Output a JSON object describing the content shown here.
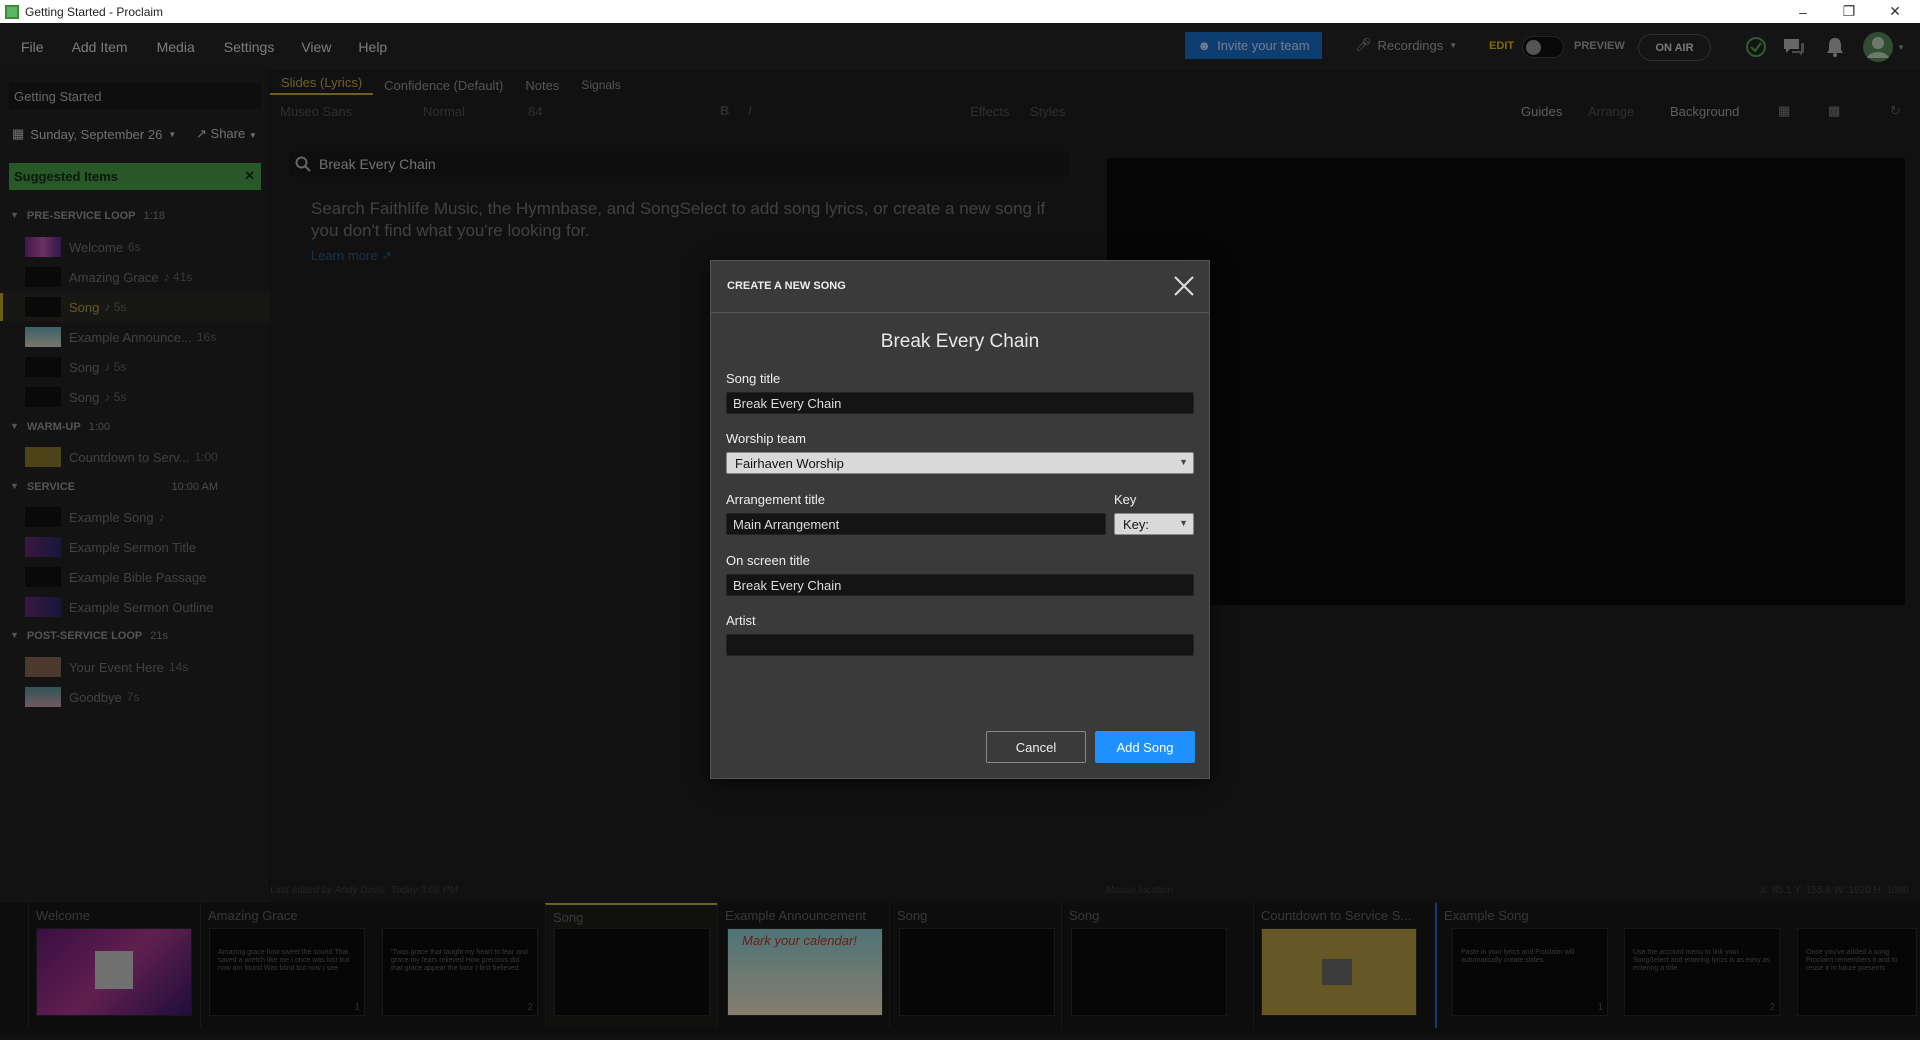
{
  "window": {
    "title": "Getting Started - Proclaim"
  },
  "menu": [
    "File",
    "Add Item",
    "Media",
    "Settings",
    "View",
    "Help"
  ],
  "header": {
    "invite_label": "Invite your team",
    "recordings_label": "Recordings",
    "edit_label": "EDIT",
    "preview_label": "PREVIEW",
    "on_air_label": "ON AIR"
  },
  "sidebar": {
    "plan_title": "Getting Started",
    "date": "Sunday, September 26",
    "share": "Share",
    "suggested": "Suggested Items",
    "sections": [
      {
        "name": "PRE-SERVICE LOOP",
        "duration": "1:18"
      },
      {
        "name": "WARM-UP",
        "duration": "1:00"
      },
      {
        "name": "SERVICE",
        "duration": "10:00 AM"
      },
      {
        "name": "POST-SERVICE LOOP",
        "duration": "21s"
      }
    ],
    "items": [
      {
        "label": "Welcome",
        "dur": "6s"
      },
      {
        "label": "Amazing Grace",
        "dur": "♪ 41s"
      },
      {
        "label": "Song",
        "dur": "♪ 5s"
      },
      {
        "label": "Example Announce...",
        "dur": "16s"
      },
      {
        "label": "Song",
        "dur": "♪ 5s"
      },
      {
        "label": "Song",
        "dur": "♪ 5s"
      },
      {
        "label": "Countdown to Serv...",
        "dur": "1:00"
      },
      {
        "label": "Example Song",
        "dur": "♪"
      },
      {
        "label": "Example Sermon Title",
        "dur": ""
      },
      {
        "label": "Example Bible Passage",
        "dur": ""
      },
      {
        "label": "Example Sermon Outline",
        "dur": ""
      },
      {
        "label": "Your Event Here",
        "dur": "14s"
      },
      {
        "label": "Goodbye",
        "dur": "7s"
      }
    ]
  },
  "editor": {
    "tabs": [
      "Slides (Lyrics)",
      "Confidence (Default)",
      "Notes",
      "Signals"
    ],
    "toolbar": {
      "font": "Museo Sans",
      "weight": "Normal",
      "size": "84",
      "guides": "Guides",
      "arrange": "Arrange",
      "background": "Background",
      "effects": "Effects",
      "styles": "Styles"
    },
    "search_value": "Break Every Chain",
    "search_help": "Search Faithlife Music, the Hymnbase, and SongSelect to add song lyrics, or create a new song if you don't find what you're looking for.",
    "learn_more": "Learn more"
  },
  "status": {
    "last_edited": "Last edited by Andy Davis, Today 3:06 PM",
    "mouse": "Mouse location",
    "coords": "X: 85.1  Y: 155.6  W: 1920  H: 1080"
  },
  "strip": {
    "groups": [
      "Welcome",
      "Amazing Grace",
      "Song",
      "Example Announcement",
      "Song",
      "Song",
      "Countdown to Service S...",
      "Example Song"
    ],
    "slides": [
      {
        "text": "",
        "n": ""
      },
      {
        "text": "Amazing grace how sweet the sound That saved a wretch like me I once was lost but now am found Was blind but now I see",
        "n": "1"
      },
      {
        "text": "'Twas grace that taught my heart to fear and grace my fears relieved How precious did that grace appear the hour I first believed",
        "n": "2"
      },
      {
        "text": "",
        "n": ""
      },
      {
        "text": "Mark your calendar!",
        "n": ""
      },
      {
        "text": "",
        "n": ""
      },
      {
        "text": "",
        "n": ""
      },
      {
        "text": "",
        "n": ""
      },
      {
        "text": "Paste in your lyrics and Proclaim will automatically create slides.",
        "n": "1"
      },
      {
        "text": "Use the account menu to link your SongSelect and entering lyrics is as easy as entering a title",
        "n": "2"
      },
      {
        "text": "Once you've added a song Proclaim remembers it and to reuse it in future presents",
        "n": ""
      }
    ]
  },
  "dialog": {
    "title": "CREATE A NEW SONG",
    "song_heading": "Break Every Chain",
    "song_title_label": "Song title",
    "song_title_value": "Break Every Chain",
    "worship_team_label": "Worship team",
    "worship_team_value": "Fairhaven Worship",
    "arrangement_label": "Arrangement title",
    "arrangement_value": "Main Arrangement",
    "key_label": "Key",
    "key_value": "Key:",
    "onscreen_label": "On screen title",
    "onscreen_value": "Break Every Chain",
    "artist_label": "Artist",
    "artist_value": "",
    "cancel": "Cancel",
    "add": "Add Song"
  },
  "colors": {
    "accent": "#1e90ff",
    "suggested": "#4a9e4a",
    "selected": "#c9b040"
  }
}
